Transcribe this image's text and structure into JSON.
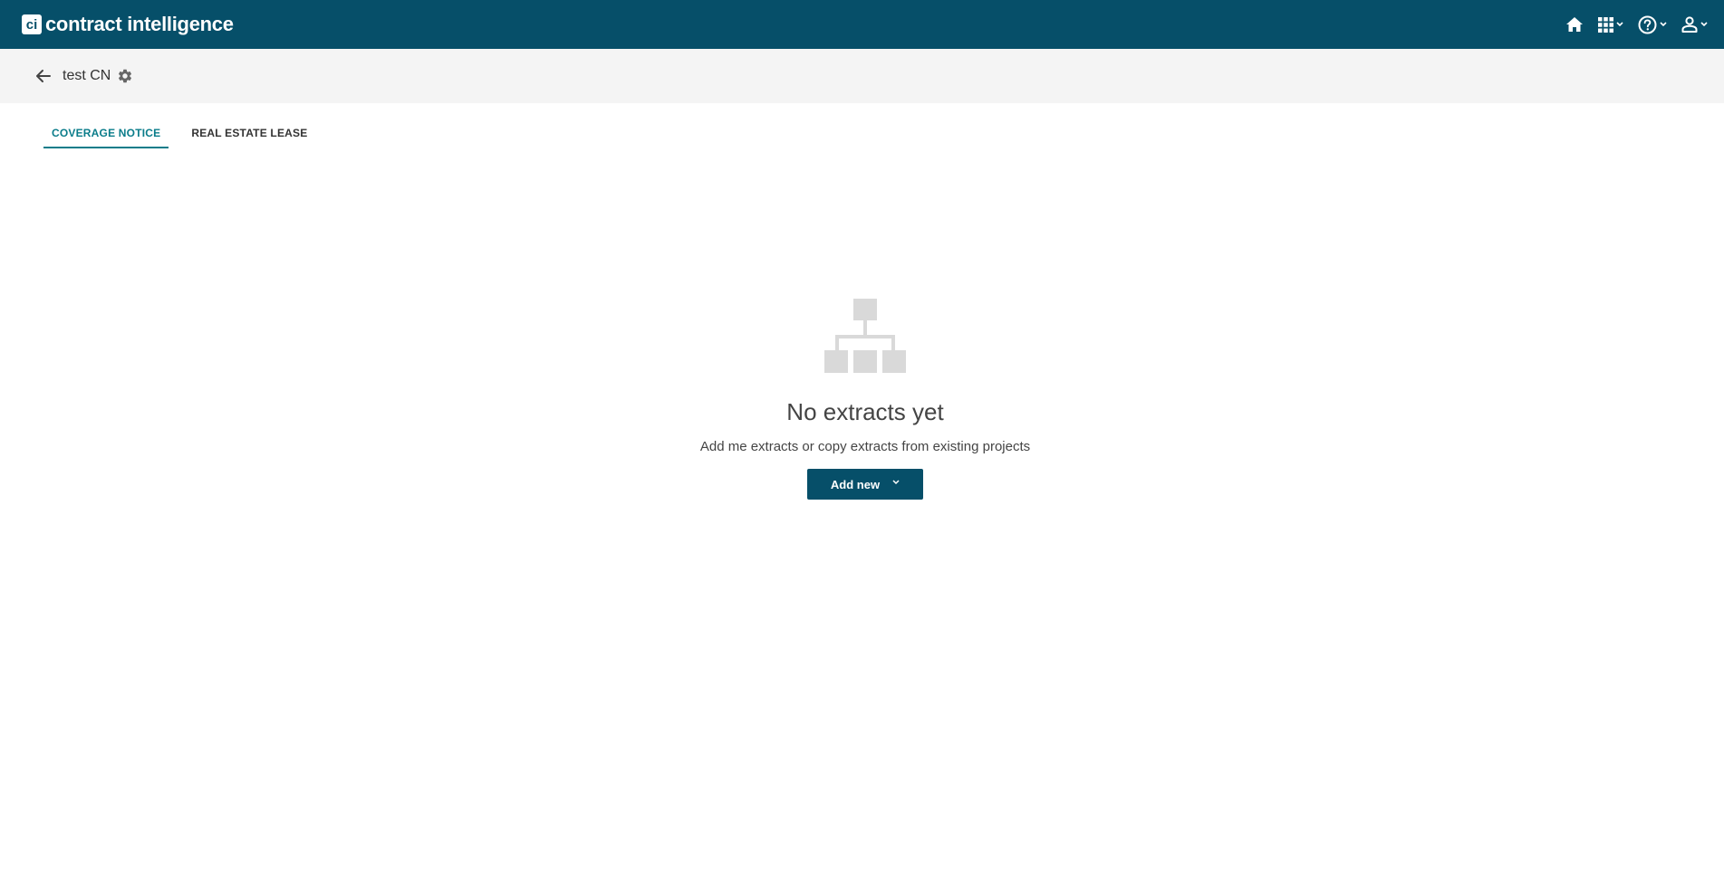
{
  "header": {
    "logo_badge": "ci",
    "logo_text": "contract intelligence",
    "icons": [
      "home-icon",
      "apps-grid-icon",
      "help-icon",
      "user-icon"
    ],
    "brand_color": "#064f69"
  },
  "project": {
    "title": "test CN"
  },
  "tabs": [
    {
      "label": "COVERAGE NOTICE",
      "active": true
    },
    {
      "label": "REAL ESTATE LEASE",
      "active": false
    }
  ],
  "empty_state": {
    "icon": "sitemap-icon",
    "title": "No extracts yet",
    "subtitle": "Add me extracts or copy extracts from existing projects",
    "button_label": "Add new"
  },
  "colors": {
    "accent": "#0a7c8a",
    "subbar_bg": "#f4f4f4",
    "icon_gray": "#d9d9d9"
  }
}
